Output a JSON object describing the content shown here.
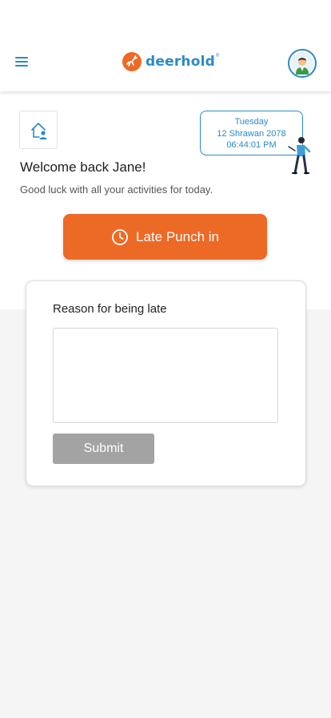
{
  "header": {
    "brand_name": "deerhold",
    "brand_mark": "®",
    "menu_icon": "hamburger-menu-icon",
    "logo_icon": "deer-logo-icon",
    "avatar_icon": "user-avatar-icon",
    "brand_color": "#2a8ac9",
    "logo_color": "#ed6a26"
  },
  "date_card": {
    "day": "Tuesday",
    "date": "12 Shrawan 2078",
    "time": "06:44:01 PM"
  },
  "home_icon": "home-user-icon",
  "greeting": {
    "title": "Welcome back Jane!",
    "subtitle": "Good luck with all your activities for today."
  },
  "punch": {
    "label": "Late Punch in",
    "icon": "clock-icon",
    "color": "#ed6a26"
  },
  "reason_form": {
    "label": "Reason for being late",
    "value": "",
    "placeholder": "",
    "submit_label": "Submit",
    "submit_color": "#a3a3a3"
  }
}
